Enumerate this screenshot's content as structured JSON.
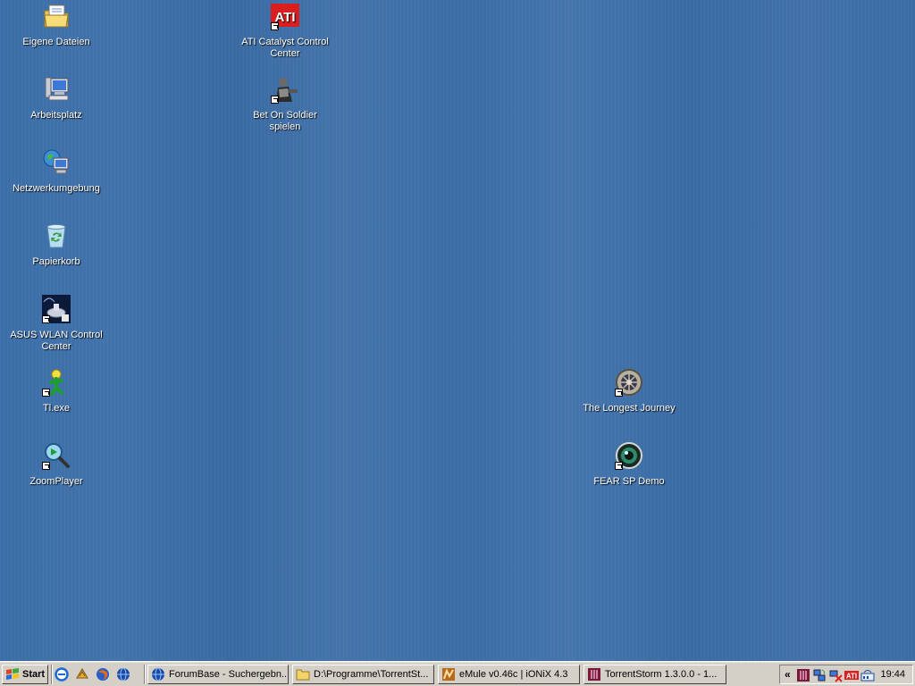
{
  "desktop": {
    "icons": [
      {
        "label": "Eigene Dateien",
        "icon": "my-documents-icon"
      },
      {
        "label": "Arbeitsplatz",
        "icon": "my-computer-icon"
      },
      {
        "label": "Netzwerkumgebung",
        "icon": "network-places-icon"
      },
      {
        "label": "Papierkorb",
        "icon": "recycle-bin-icon"
      },
      {
        "label": "ASUS WLAN Control Center",
        "icon": "asus-wlan-icon"
      },
      {
        "label": "Tl.exe",
        "icon": "tl-exe-icon"
      },
      {
        "label": "ZoomPlayer",
        "icon": "zoomplayer-icon"
      },
      {
        "label": "ATI Catalyst Control Center",
        "icon": "ati-catalyst-icon"
      },
      {
        "label": "Bet On Soldier spielen",
        "icon": "bet-on-soldier-icon"
      },
      {
        "label": "The Longest Journey",
        "icon": "longest-journey-icon"
      },
      {
        "label": "FEAR SP Demo",
        "icon": "fear-demo-icon"
      }
    ]
  },
  "taskbar": {
    "start_label": "Start",
    "quicklaunch": [
      "internet-explorer-icon",
      "winamp-icon",
      "firefox-icon",
      "globe-icon"
    ],
    "tasks": [
      {
        "label": "ForumBase - Suchergebn...",
        "icon": "globe-icon"
      },
      {
        "label": "D:\\Programme\\TorrentSt...",
        "icon": "folder-icon"
      },
      {
        "label": "eMule v0.46c | iONiX 4.3",
        "icon": "emule-icon"
      },
      {
        "label": "TorrentStorm 1.3.0.0 - 1...",
        "icon": "torrentstorm-icon"
      }
    ],
    "tray": {
      "expand_label": "«",
      "icons": [
        "torrentstorm-tray-icon",
        "network-tray-icon",
        "network-disconnected-icon",
        "ati-tray-icon",
        "wlan-tray-icon"
      ],
      "clock": "19:44"
    }
  },
  "colors": {
    "desktop": "#3a6ea5",
    "taskbar": "#d4d0c8"
  }
}
